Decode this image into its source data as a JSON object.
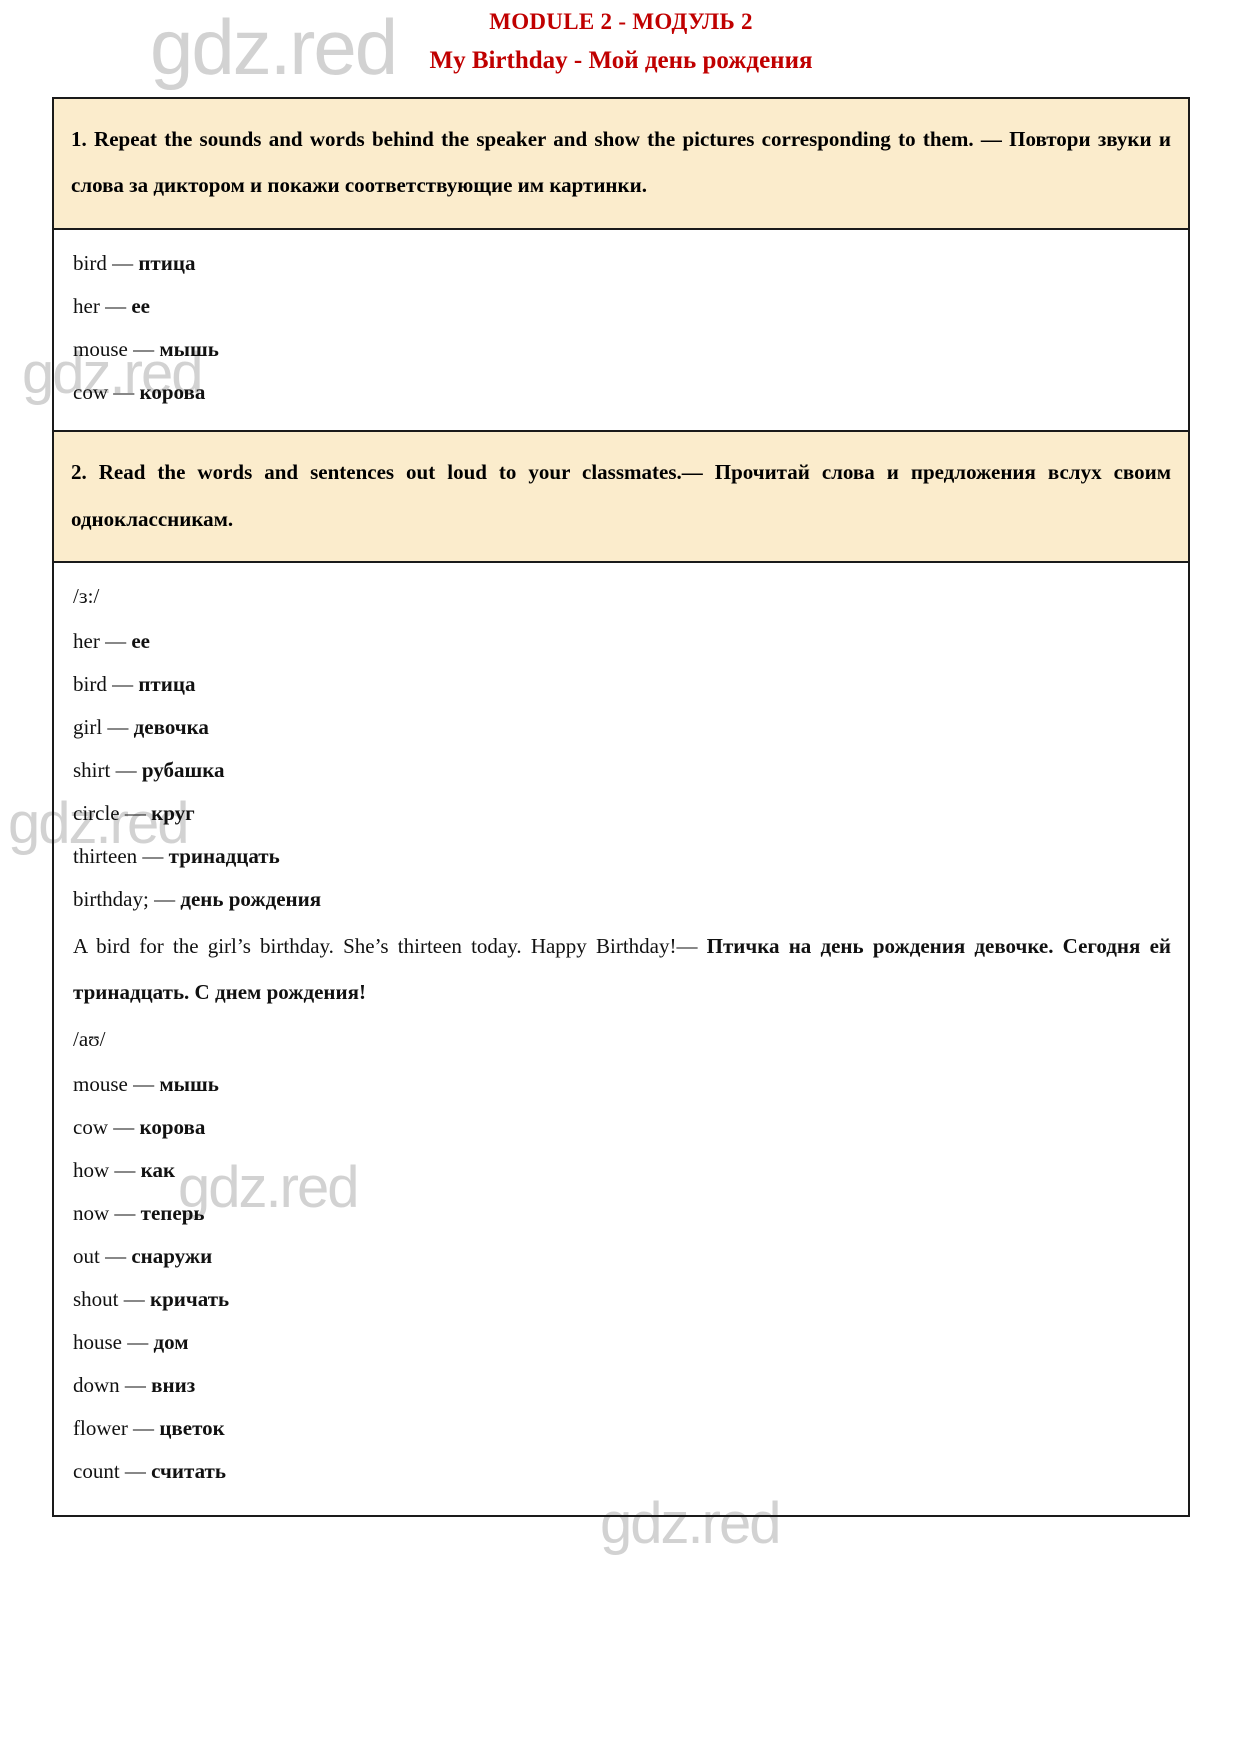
{
  "watermark": {
    "text": "gdz.red"
  },
  "heading": {
    "module_line": "MODULE 2 - МОДУЛЬ 2",
    "title_line": "My Birthday - Мой день рождения"
  },
  "task1": {
    "instruction": "1. Repeat the sounds and words behind the speaker and show the pictures corresponding to them. — Повтори звуки и слова за диктором и покажи соответствующие им картинки.",
    "words": [
      {
        "en": "bird — ",
        "ru": "птица"
      },
      {
        "en": "her —  ",
        "ru": "ee"
      },
      {
        "en": "mouse — ",
        "ru": "мышь"
      },
      {
        "en": "cow — ",
        "ru": "корова"
      }
    ]
  },
  "task2": {
    "instruction": "2. Read the words and sentences out loud to your classmates.— Прочитай слова и предложения вслух своим одноклассникам.",
    "section1": {
      "phonetic": "/ɜ:/",
      "words": [
        {
          "en": "her — ",
          "ru": "ee"
        },
        {
          "en": "bird — ",
          "ru": "птица"
        },
        {
          "en": "girl — ",
          "ru": "девочка"
        },
        {
          "en": "shirt — ",
          "ru": "рубашка"
        },
        {
          "en": "circle — ",
          "ru": "круг"
        },
        {
          "en": "thirteen — ",
          "ru": "тринадцать"
        },
        {
          "en": "birthday; — ",
          "ru": "день рождения"
        }
      ],
      "sentence_en": "A bird for the girl’s birthday. She’s thirteen today. Happy Birthday!— ",
      "sentence_ru": "Птичка на день рождения девочке. Сегодня ей тринадцать. С днем рождения!"
    },
    "section2": {
      "phonetic": "/aʊ/",
      "words": [
        {
          "en": "mouse — ",
          "ru": "мышь"
        },
        {
          "en": "cow — ",
          "ru": "корова"
        },
        {
          "en": "how — ",
          "ru": "как"
        },
        {
          "en": "now — ",
          "ru": "теперь"
        },
        {
          "en": "out — ",
          "ru": "снаружи"
        },
        {
          "en": "shout — ",
          "ru": "кричать"
        },
        {
          "en": "house — ",
          "ru": "дом"
        },
        {
          "en": "down — ",
          "ru": "вниз"
        },
        {
          "en": "flower — ",
          "ru": "цветок"
        },
        {
          "en": "count — ",
          "ru": "считать"
        }
      ]
    }
  },
  "colors": {
    "heading_red": "#c00000",
    "band_cream": "#fbeccc",
    "border_black": "#1a1a1a",
    "watermark_gray": "#d2d2d2"
  }
}
